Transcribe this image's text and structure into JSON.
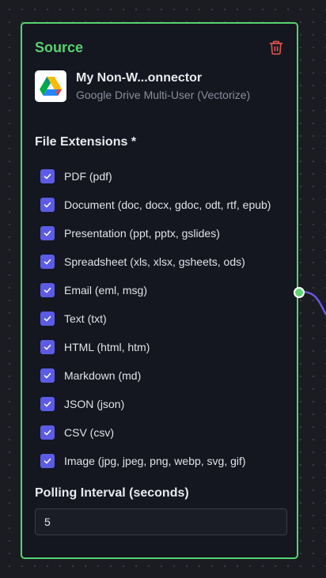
{
  "node": {
    "title": "Source",
    "connector_name": "My Non-W...onnector",
    "connector_type": "Google Drive Multi-User (Vectorize)"
  },
  "file_extensions": {
    "label": "File Extensions *",
    "options": [
      {
        "label": "PDF (pdf)",
        "checked": true
      },
      {
        "label": "Document (doc, docx, gdoc, odt, rtf, epub)",
        "checked": true
      },
      {
        "label": "Presentation (ppt, pptx, gslides)",
        "checked": true
      },
      {
        "label": "Spreadsheet (xls, xlsx, gsheets, ods)",
        "checked": true
      },
      {
        "label": "Email (eml, msg)",
        "checked": true
      },
      {
        "label": "Text (txt)",
        "checked": true
      },
      {
        "label": "HTML (html, htm)",
        "checked": true
      },
      {
        "label": "Markdown (md)",
        "checked": true
      },
      {
        "label": "JSON (json)",
        "checked": true
      },
      {
        "label": "CSV (csv)",
        "checked": true
      },
      {
        "label": "Image (jpg, jpeg, png, webp, svg, gif)",
        "checked": true
      }
    ]
  },
  "polling": {
    "label": "Polling Interval (seconds)",
    "value": "5"
  },
  "colors": {
    "accent_green": "#57d26e",
    "checkbox": "#5b5be6",
    "edge": "#6a55e0",
    "trash": "#e0524c"
  },
  "icons": {
    "delete": "trash-icon",
    "connector": "google-drive-icon",
    "check": "check-icon"
  }
}
